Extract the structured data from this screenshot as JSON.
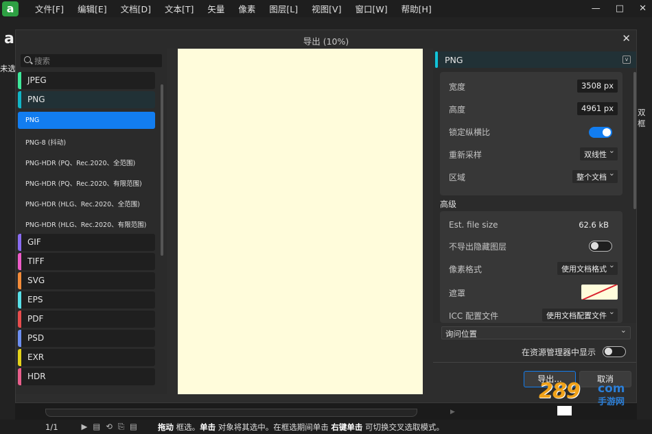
{
  "menubar": {
    "logo": "a",
    "items": [
      "文件[F]",
      "编辑[E]",
      "文档[D]",
      "文本[T]",
      "矢量",
      "像素",
      "图层[L]",
      "视图[V]",
      "窗口[W]",
      "帮助[H]"
    ],
    "controls": [
      "—",
      "□",
      "✕"
    ]
  },
  "background": {
    "untitled_tab": "未选",
    "right_panel_text": "双框",
    "status_page": "1/1",
    "status_icons": "▶▤⟲⎘▤",
    "status_hint": {
      "b1": "拖动",
      "t1": " 框选。",
      "b2": "单击",
      "t2": " 对象将其选中。在框选期间单击 ",
      "b3": "右键单击",
      "t3": " 可切换交叉选取模式。"
    }
  },
  "watermark": {
    "num": "289",
    "com": "com",
    "cn": "手游网"
  },
  "dialog": {
    "title": "导出 (10%)",
    "close": "✕",
    "search_placeholder": "搜索",
    "formats": [
      {
        "label": "JPEG",
        "color": "#3ee89a"
      },
      {
        "label": "PNG",
        "color": "#12b5c6"
      },
      {
        "label": "GIF",
        "color": "#8a6cf2"
      },
      {
        "label": "TIFF",
        "color": "#ee5cc8"
      },
      {
        "label": "SVG",
        "color": "#f48c3a"
      },
      {
        "label": "EPS",
        "color": "#58e0e8"
      },
      {
        "label": "PDF",
        "color": "#e84d4d"
      },
      {
        "label": "PSD",
        "color": "#6d8ff0"
      },
      {
        "label": "EXR",
        "color": "#e4d21a"
      },
      {
        "label": "HDR",
        "color": "#e95f8c"
      }
    ],
    "png_presets": [
      "PNG",
      "PNG-8 (抖动)",
      "PNG-HDR (PQ、Rec.2020、全范围)",
      "PNG-HDR (PQ、Rec.2020、有限范围)",
      "PNG-HDR (HLG、Rec.2020、全范围)",
      "PNG-HDR (HLG、Rec.2020、有限范围)"
    ],
    "settings": {
      "format": "PNG",
      "width_label": "宽度",
      "width_value": "3508 px",
      "height_label": "高度",
      "height_value": "4961 px",
      "lock_label": "锁定纵横比",
      "lock_on": true,
      "resample_label": "重新采样",
      "resample_value": "双线性",
      "area_label": "区域",
      "area_value": "整个文档",
      "advanced_title": "高级",
      "filesize_label": "Est. file size",
      "filesize_value": "62.6 kB",
      "hidden_layers_label": "不导出隐藏图层",
      "hidden_layers_on": false,
      "pixel_format_label": "像素格式",
      "pixel_format_value": "使用文档格式",
      "matte_label": "遮罩",
      "icc_label": "ICC 配置文件",
      "icc_value": "使用文档配置文件"
    },
    "location_value": "询问位置",
    "reveal_label": "在资源管理器中显示",
    "reveal_on": false,
    "export_label": "导出...",
    "cancel_label": "取消"
  },
  "colors": {
    "accent": "#127df0",
    "preview_bg": "#fffcdb",
    "png_accent": "#12c4d8"
  }
}
